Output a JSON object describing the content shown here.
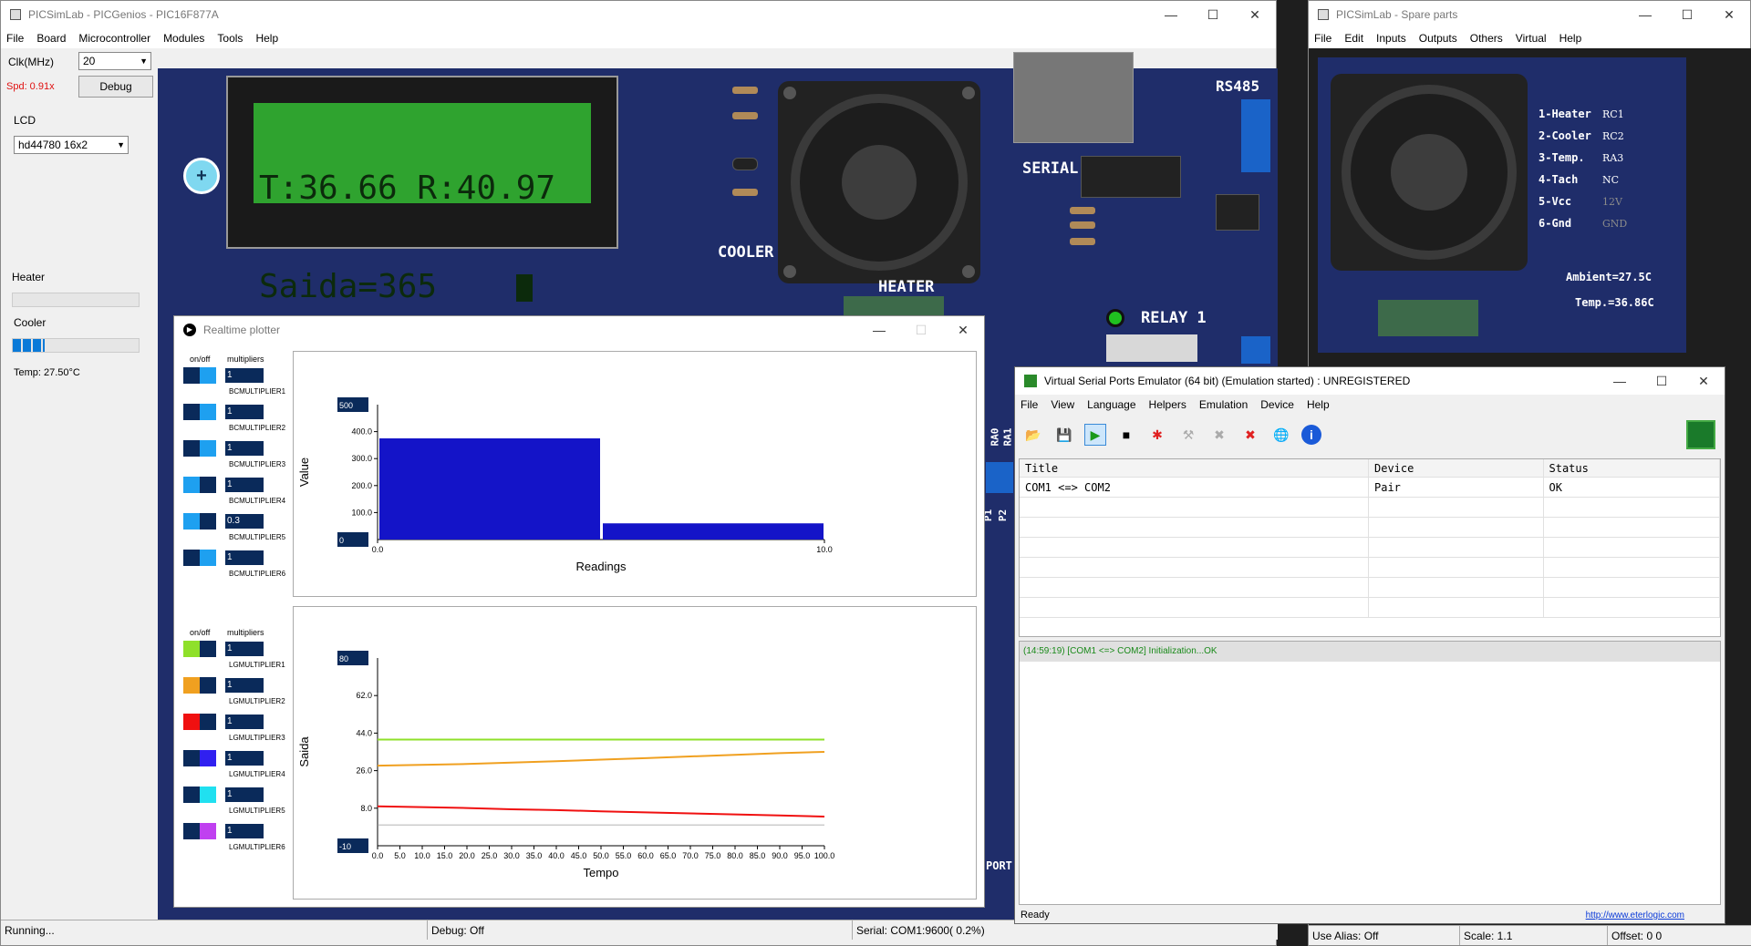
{
  "main": {
    "title": "PICSimLab - PICGenios - PIC16F877A",
    "menu": [
      "File",
      "Board",
      "Microcontroller",
      "Modules",
      "Tools",
      "Help"
    ],
    "clk_label": "Clk(MHz)",
    "clk_value": "20",
    "spd": "Spd: 0.91x",
    "debug_button": "Debug",
    "lcd_label": "LCD",
    "lcd_value": "hd44780 16x2",
    "heater_label": "Heater",
    "heater_level": 0,
    "cooler_label": "Cooler",
    "cooler_level": 0.25,
    "temp": "Temp: 27.50°C",
    "status_running": "Running...",
    "status_debug": "Debug: Off",
    "status_serial": "Serial: COM1:9600( 0.2%)",
    "lcd_line1": "T:36.66 R:40.97",
    "lcd_line2": "Saida=365",
    "board_labels": {
      "cooler": "COOLER",
      "heater": "HEATER",
      "serial": "SERIAL",
      "rs485": "RS485",
      "relay": "RELAY 1",
      "ra0": "RA0",
      "ra1": "RA1",
      "p1": "P1",
      "p2": "P2",
      "port": "PORT"
    }
  },
  "spare": {
    "title": "PICSimLab - Spare parts",
    "menu": [
      "File",
      "Edit",
      "Inputs",
      "Outputs",
      "Others",
      "Virtual",
      "Help"
    ],
    "pins": [
      {
        "name": "1-Heater",
        "val": "RC1"
      },
      {
        "name": "2-Cooler",
        "val": "RC2"
      },
      {
        "name": "3-Temp.",
        "val": "RA3"
      },
      {
        "name": "4-Tach",
        "val": "NC"
      },
      {
        "name": "5-Vcc",
        "val": "12V"
      },
      {
        "name": "6-Gnd",
        "val": "GND"
      }
    ],
    "ambient": "Ambient=27.5C",
    "temp": "Temp.=36.86C",
    "status_alias": "Use Alias: Off",
    "status_scale": "Scale: 1.1",
    "status_offset": "Offset:  0  0"
  },
  "plotter": {
    "title": "Realtime plotter",
    "onoff": "on/off",
    "multipliers": "multipliers",
    "bc_rows": [
      {
        "val": "1",
        "label": "BCMULTIPLIER1",
        "colorA": "#0a2a5a",
        "colorB": "#1ea0f0"
      },
      {
        "val": "1",
        "label": "BCMULTIPLIER2",
        "colorA": "#0a2a5a",
        "colorB": "#1ea0f0"
      },
      {
        "val": "1",
        "label": "BCMULTIPLIER3",
        "colorA": "#0a2a5a",
        "colorB": "#1ea0f0"
      },
      {
        "val": "1",
        "label": "BCMULTIPLIER4",
        "colorA": "#1ea0f0",
        "colorB": "#0a2a5a"
      },
      {
        "val": "0.3",
        "label": "BCMULTIPLIER5",
        "colorA": "#1ea0f0",
        "colorB": "#0a2a5a"
      },
      {
        "val": "1",
        "label": "BCMULTIPLIER6",
        "colorA": "#0a2a5a",
        "colorB": "#1ea0f0"
      }
    ],
    "lg_rows": [
      {
        "val": "1",
        "label": "LGMULTIPLIER1",
        "colorA": "#8fe02a",
        "colorB": "#0a2a5a"
      },
      {
        "val": "1",
        "label": "LGMULTIPLIER2",
        "colorA": "#f0a020",
        "colorB": "#0a2a5a"
      },
      {
        "val": "1",
        "label": "LGMULTIPLIER3",
        "colorA": "#f01010",
        "colorB": "#0a2a5a"
      },
      {
        "val": "1",
        "label": "LGMULTIPLIER4",
        "colorA": "#0a2a5a",
        "colorB": "#3020f0"
      },
      {
        "val": "1",
        "label": "LGMULTIPLIER5",
        "colorA": "#0a2a5a",
        "colorB": "#20e0f0"
      },
      {
        "val": "1",
        "label": "LGMULTIPLIER6",
        "colorA": "#0a2a5a",
        "colorB": "#c040f0"
      }
    ]
  },
  "chart_data": [
    {
      "type": "bar",
      "xlabel": "Readings",
      "ylabel": "Value",
      "ylim_box_top": "500",
      "ylim_box_bottom": "0",
      "ylim": [
        0,
        500
      ],
      "xlim": [
        0,
        10
      ],
      "yticks": [
        "400.0",
        "300.0",
        "200.0",
        "100.0"
      ],
      "xticks": [
        "0.0",
        "10.0"
      ],
      "bars": [
        {
          "x0": 0,
          "x1": 5,
          "value": 375
        },
        {
          "x0": 5,
          "x1": 10,
          "value": 60
        }
      ],
      "color": "#1414c8"
    },
    {
      "type": "line",
      "xlabel": "Tempo",
      "ylabel": "Saida",
      "ylim_box_top": "80",
      "ylim_box_bottom": "-10",
      "ylim": [
        -10,
        80
      ],
      "xlim": [
        0,
        100
      ],
      "yticks": [
        "62.0",
        "44.0",
        "26.0",
        "8.0"
      ],
      "xticks": [
        "0.0",
        "5.0",
        "10.0",
        "15.0",
        "20.0",
        "25.0",
        "30.0",
        "35.0",
        "40.0",
        "45.0",
        "50.0",
        "55.0",
        "60.0",
        "65.0",
        "70.0",
        "75.0",
        "80.0",
        "85.0",
        "90.0",
        "95.0",
        "100.0"
      ],
      "series": [
        {
          "color": "#8fe02a",
          "x": [
            0,
            100
          ],
          "values": [
            40.9,
            40.9
          ]
        },
        {
          "color": "#f0a020",
          "x": [
            0,
            20,
            40,
            50,
            60,
            70,
            80,
            90,
            100
          ],
          "values": [
            28.4,
            29.2,
            30.5,
            31.3,
            32.0,
            32.8,
            33.6,
            34.4,
            35.0
          ]
        },
        {
          "color": "#f01010",
          "x": [
            0,
            10,
            20,
            30,
            40,
            50,
            60,
            70,
            80,
            90,
            100
          ],
          "values": [
            8.9,
            8.5,
            8.1,
            7.5,
            7.1,
            6.5,
            6.0,
            5.5,
            5.0,
            4.5,
            4.0
          ]
        }
      ]
    }
  ],
  "vspe": {
    "title": "Virtual Serial Ports Emulator (64 bit) (Emulation started) : UNREGISTERED",
    "menu": [
      "File",
      "View",
      "Language",
      "Helpers",
      "Emulation",
      "Device",
      "Help"
    ],
    "headers": [
      "Title",
      "Device",
      "Status"
    ],
    "rows": [
      [
        "COM1 <=> COM2",
        "Pair",
        "OK"
      ]
    ],
    "log": "(14:59:19) [COM1 <=> COM2] Initialization...OK",
    "status": "Ready",
    "link": "http://www.eterlogic.com"
  }
}
